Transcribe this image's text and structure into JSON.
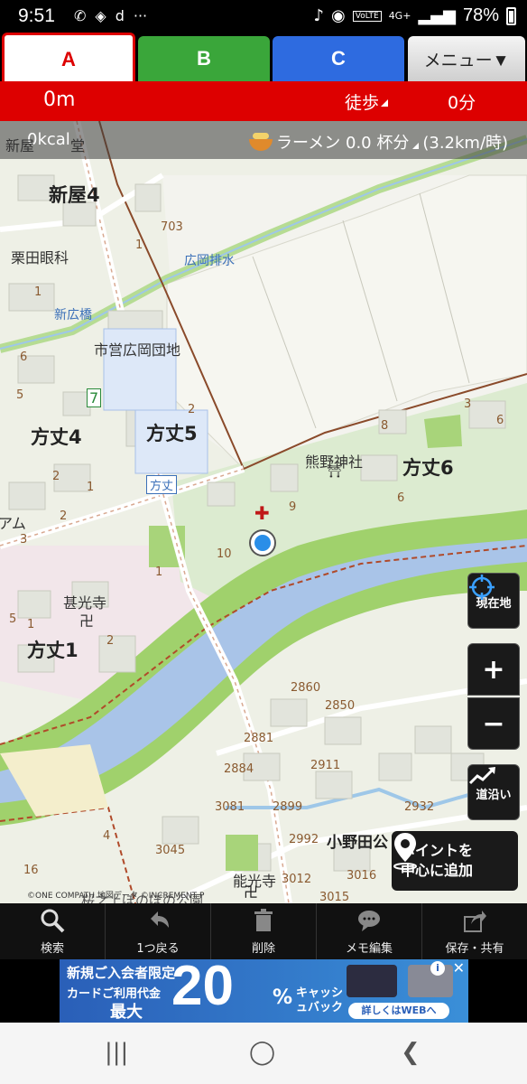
{
  "status_bar": {
    "time": "9:51",
    "left_icons": [
      "wifi-call-icon",
      "shield-icon",
      "d-icon",
      "more-icon"
    ],
    "right_icons": [
      "mute-icon",
      "location-icon",
      "volte-icon",
      "4g-icon",
      "signal-icon",
      "battery-icon"
    ],
    "network": "4G+",
    "volte": "VoLTE",
    "battery": "78%",
    "more": "···"
  },
  "tabs": {
    "a": "A",
    "b": "B",
    "c": "C",
    "menu": "メニュー▼"
  },
  "info_bar": {
    "distance": "0m",
    "mode": "徒歩",
    "time": "0分"
  },
  "overlay": {
    "calories": "0kcal",
    "ramen": "ラーメン 0.0 杯分",
    "speed": "(3.2km/時)"
  },
  "map": {
    "labels": {
      "shinya4": "新屋4",
      "kurita": "栗田眼科",
      "hirooka_haisui": "広岡排水",
      "shinhiro": "新広橋",
      "shiei": "市営広岡団地",
      "hojo4": "方丈4",
      "hojo5": "方丈5",
      "kumano": "熊野神社",
      "hojo6": "方丈6",
      "hojo_sign": "方丈",
      "jinkoji": "甚光寺",
      "hojo1": "方丈1",
      "onodakou": "小野田公",
      "nokoji": "能光寺",
      "shinya_top": "新屋",
      "do": "堂",
      "amu": "アム",
      "park": "桜之上ぽのぼの公園",
      "copyright": "©ONE COMPATH 地図データ ©INCREMENT P"
    },
    "numbers": [
      "703",
      "1",
      "1",
      "6",
      "5",
      "2",
      "1",
      "2",
      "1",
      "9",
      "10",
      "8",
      "3",
      "6",
      "6",
      "5",
      "2",
      "1",
      "3",
      "2",
      "2860",
      "2850",
      "2881",
      "2884",
      "2911",
      "3081",
      "2899",
      "2932",
      "3045",
      "2992",
      "3012",
      "3016",
      "3015",
      "16",
      "4"
    ]
  },
  "buttons": {
    "current_location": "現在地",
    "zoom_in": "+",
    "zoom_out": "−",
    "along_road": "道沿い",
    "add_point_line1": "ポイントを",
    "add_point_line2": "中心に追加"
  },
  "toolbar": {
    "search": "検索",
    "undo": "1つ戻る",
    "delete": "削除",
    "memo": "メモ編集",
    "save": "保存・共有"
  },
  "ad": {
    "line1": "新規ご入会者限定",
    "line2": "カードご利用代金",
    "line3": "最大",
    "big": "20",
    "pct": "%",
    "kb": "キャッシュバック",
    "web": "詳しくはWEBへ",
    "info": "i",
    "close": "✕"
  },
  "nav": {
    "recents": "|||",
    "home": "◯",
    "back": "❮"
  },
  "colors": {
    "tab_a": "#d00000",
    "tab_b": "#3aa63a",
    "tab_c": "#2e6be0",
    "info_bar": "#d00000",
    "river": "#a9c4e8",
    "green": "#9fd36b"
  }
}
